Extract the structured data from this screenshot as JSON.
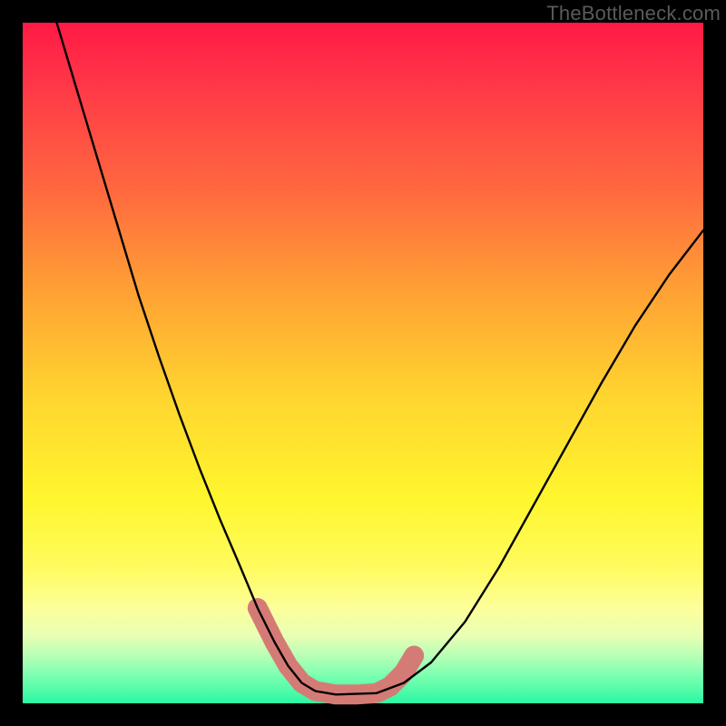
{
  "watermark": "TheBottleneck.com",
  "chart_data": {
    "type": "line",
    "title": "",
    "xlabel": "",
    "ylabel": "",
    "xlim": [
      0,
      100
    ],
    "ylim": [
      0,
      100
    ],
    "grid": false,
    "legend": false,
    "note": "No axes, ticks, or numeric labels are visible; x is a normalized 0–100 horizontal position, y is a normalized 0–100 vertical value read off the plot area (0 = bottom green band, 100 = top red band). Values are estimated from pixel positions.",
    "series": [
      {
        "name": "bottleneck-curve",
        "color": "#000000",
        "x": [
          5,
          8,
          11,
          14,
          17,
          20,
          23,
          26,
          29,
          32,
          34.5,
          37,
          39,
          41,
          43,
          46,
          52,
          56,
          60,
          65,
          70,
          75,
          80,
          85,
          90,
          95,
          100
        ],
        "y": [
          100,
          90,
          80,
          70,
          60,
          51,
          42.5,
          34.5,
          27,
          20,
          14,
          9,
          5.5,
          3,
          1.8,
          1.3,
          1.5,
          3,
          6,
          12,
          20,
          29,
          38,
          47,
          55.5,
          63,
          69.5
        ]
      }
    ],
    "highlight": {
      "name": "bottom-salmon-band",
      "color": "#d57b76",
      "description": "Thick salmon overlay on the curve near its minimum, spanning roughly x=34–57, y≈1–14.",
      "x": [
        34.5,
        37,
        39,
        41,
        43,
        46,
        49,
        52,
        54,
        56,
        57.5
      ],
      "y": [
        14,
        9,
        5.5,
        3,
        1.8,
        1.3,
        1.3,
        1.5,
        2.5,
        4.5,
        7
      ]
    },
    "background_gradient": {
      "direction": "top-to-bottom",
      "stops": [
        {
          "pos": 0.0,
          "color": "#ff1a46"
        },
        {
          "pos": 0.25,
          "color": "#ff6a3f"
        },
        {
          "pos": 0.55,
          "color": "#ffd52f"
        },
        {
          "pos": 0.8,
          "color": "#fffb5e"
        },
        {
          "pos": 0.93,
          "color": "#b7ffb5"
        },
        {
          "pos": 1.0,
          "color": "#2bf7a3"
        }
      ]
    }
  }
}
